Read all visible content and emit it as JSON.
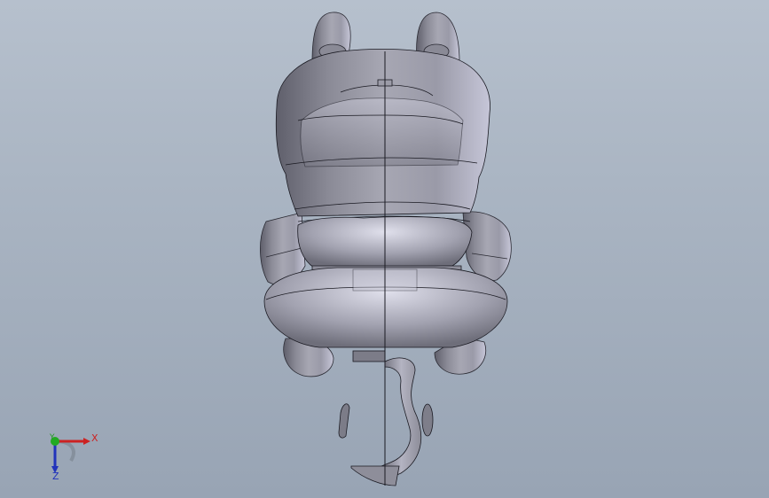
{
  "viewport": {
    "background_top": "#b6c0cd",
    "background_bottom": "#98a4b4"
  },
  "model": {
    "body_color": "#9a9aa6",
    "edge_color": "#1a1a22"
  },
  "triad": {
    "x_label": "X",
    "y_label": "Y",
    "z_label": "Z",
    "x_color": "#cc2222",
    "y_color": "#229922",
    "z_color": "#2233bb"
  }
}
